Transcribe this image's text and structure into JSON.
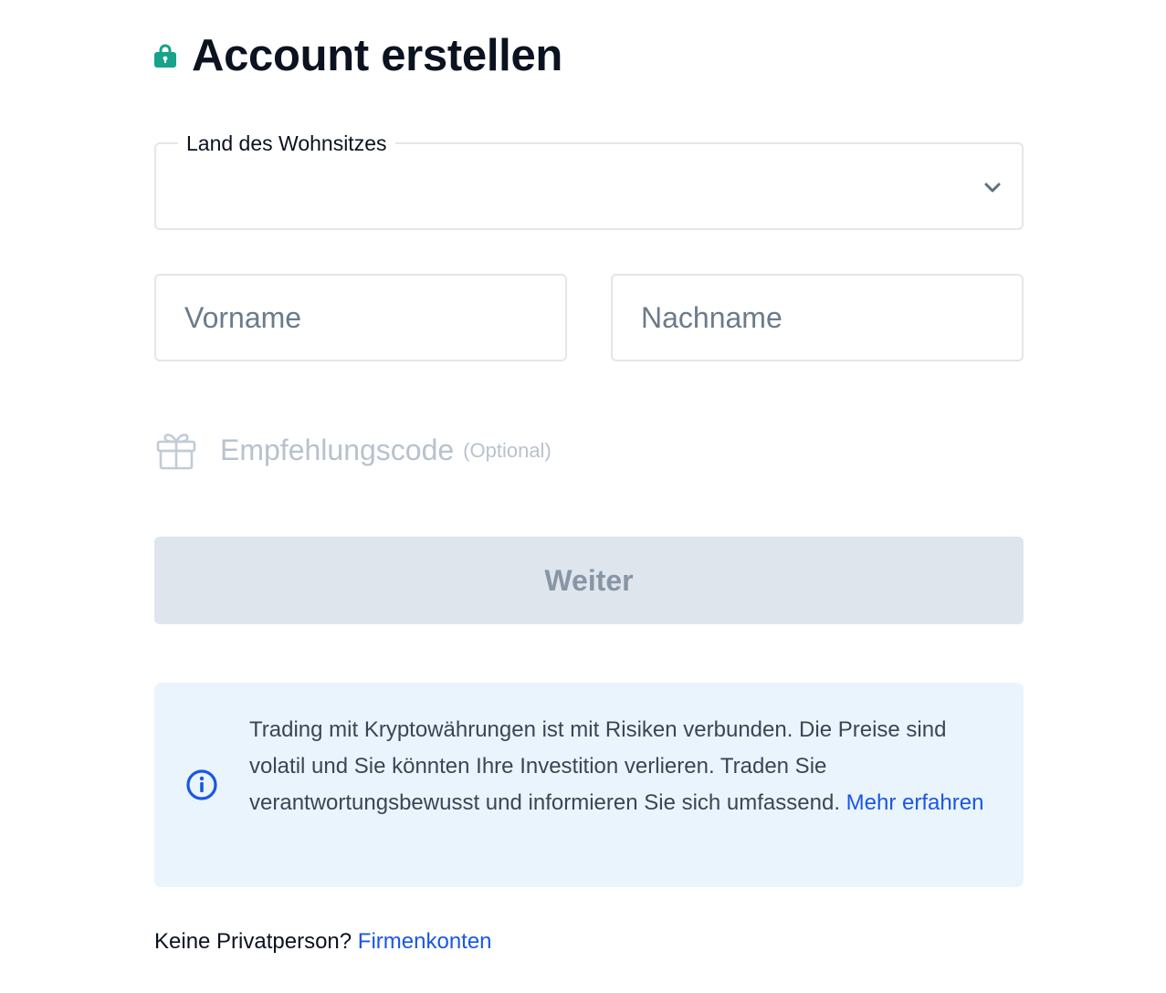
{
  "header": {
    "title": "Account erstellen",
    "icon": "lock-icon",
    "icon_color": "#16a38a"
  },
  "form": {
    "country": {
      "label": "Land des Wohnsitzes",
      "value": "",
      "icon": "chevron-down-icon"
    },
    "first_name": {
      "placeholder": "Vorname",
      "value": ""
    },
    "last_name": {
      "placeholder": "Nachname",
      "value": ""
    },
    "referral": {
      "label": "Empfehlungscode",
      "optional": "(Optional)",
      "icon": "gift-icon"
    },
    "continue_label": "Weiter"
  },
  "notice": {
    "icon": "info-icon",
    "text": "Trading mit Kryptowährungen ist mit Risiken verbunden. Die Preise sind volatil und Sie könnten Ihre Investition verlieren. Traden Sie verantwortungsbewusst und informieren Sie sich umfassend. ",
    "link": "Mehr erfahren",
    "accent": "#1a56e6"
  },
  "footer": {
    "text": "Keine Privatperson? ",
    "link": "Firmenkonten"
  }
}
